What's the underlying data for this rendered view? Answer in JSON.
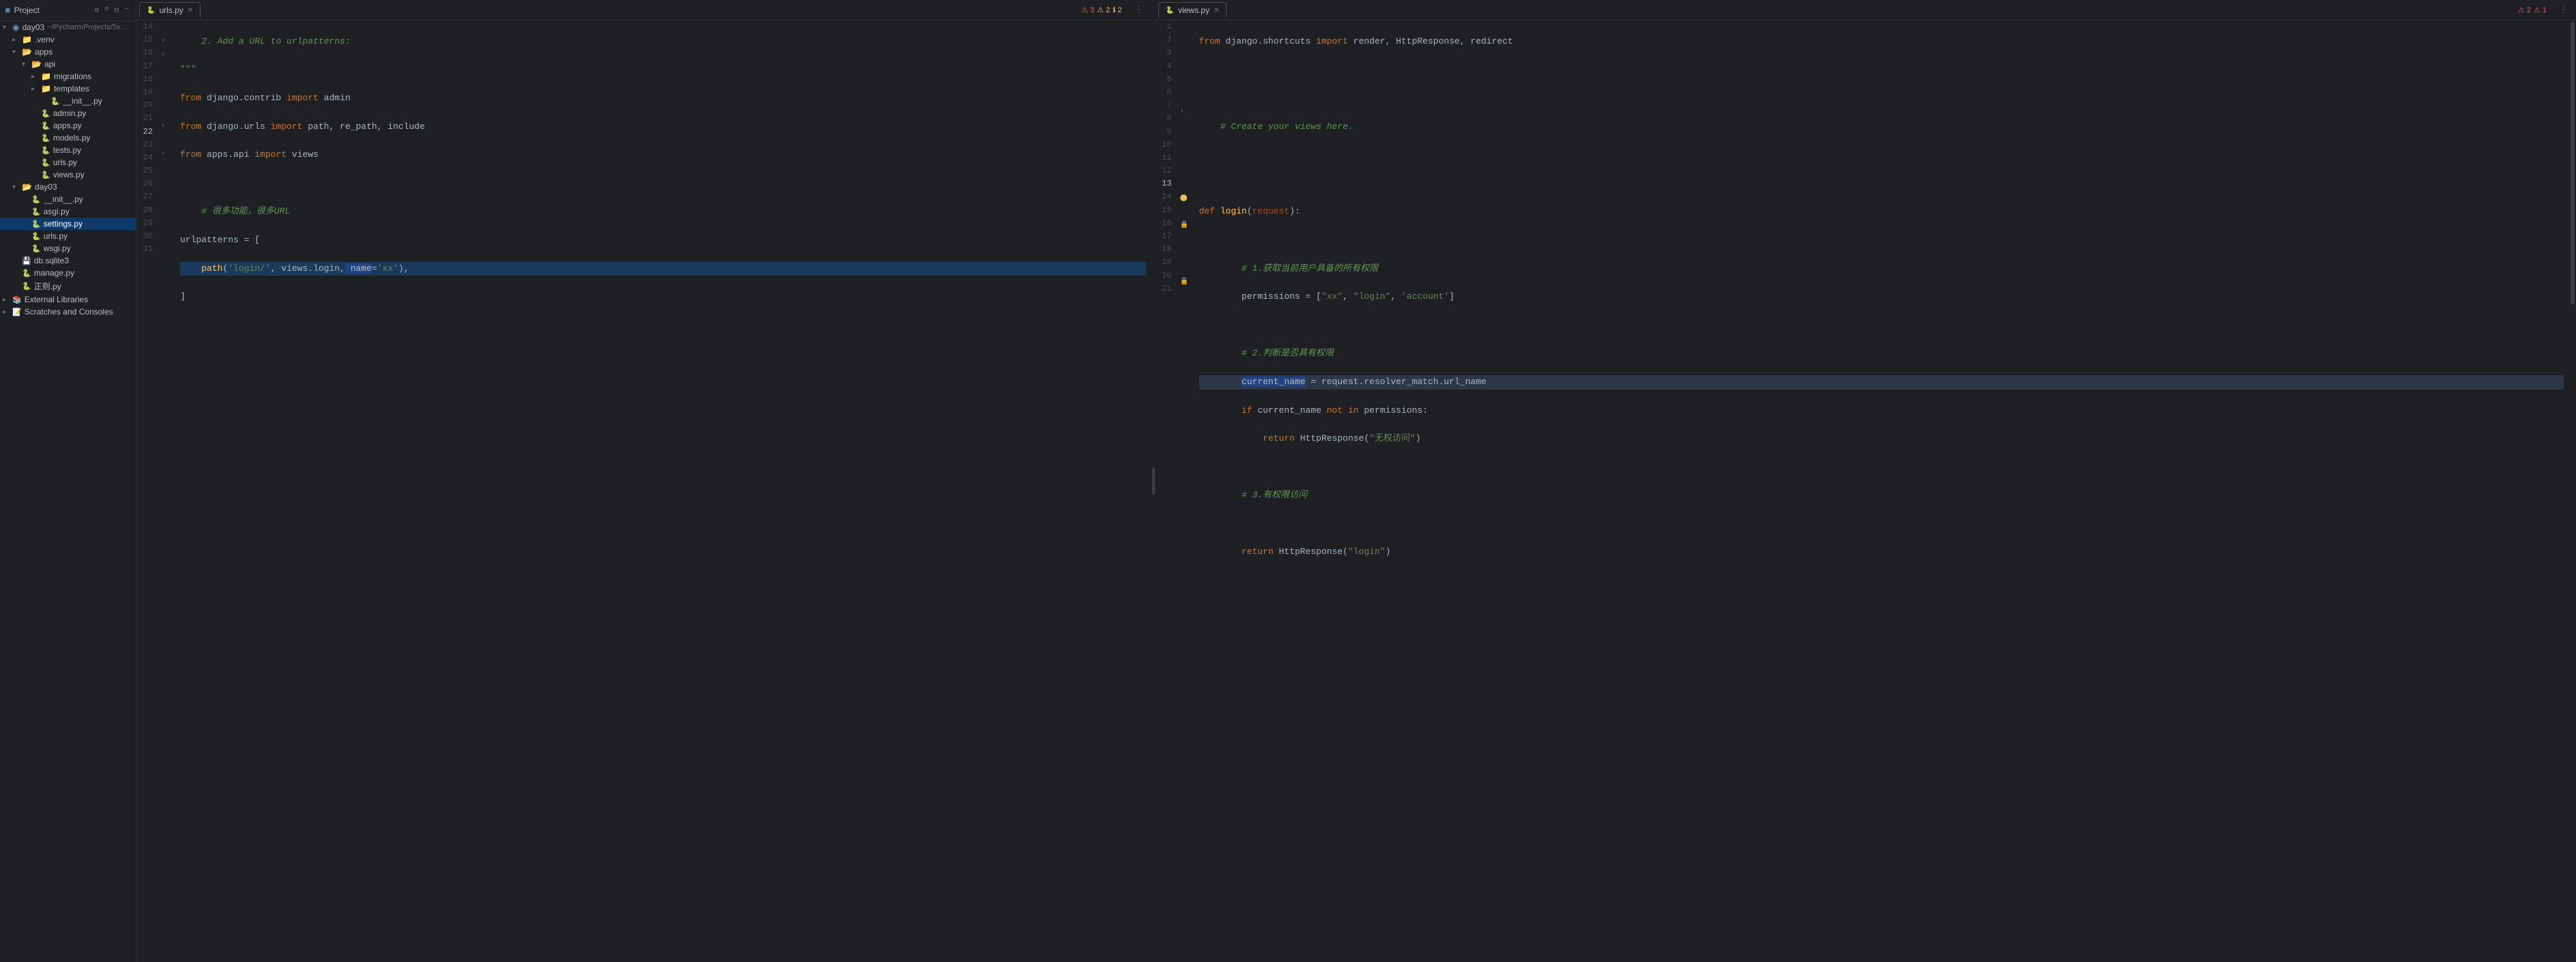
{
  "sidebar": {
    "title": "Project",
    "root": {
      "label": "day03",
      "sublabel": "~/PycharmProjects/5x...",
      "expanded": true
    },
    "items": [
      {
        "id": "venv",
        "label": ".venv",
        "type": "folder",
        "depth": 1,
        "expanded": true
      },
      {
        "id": "apps",
        "label": "apps",
        "type": "folder",
        "depth": 1,
        "expanded": true
      },
      {
        "id": "api",
        "label": "api",
        "type": "folder",
        "depth": 2,
        "expanded": true
      },
      {
        "id": "migrations",
        "label": "migrations",
        "type": "folder",
        "depth": 3,
        "expanded": false
      },
      {
        "id": "templates",
        "label": "templates",
        "type": "folder",
        "depth": 3,
        "expanded": false
      },
      {
        "id": "init_api",
        "label": "__init__.py",
        "type": "py",
        "depth": 4,
        "expanded": false
      },
      {
        "id": "admin_py",
        "label": "admin.py",
        "type": "py",
        "depth": 3,
        "expanded": false
      },
      {
        "id": "apps_py",
        "label": "apps.py",
        "type": "py",
        "depth": 3,
        "expanded": false
      },
      {
        "id": "models_py",
        "label": "models.py",
        "type": "py",
        "depth": 3,
        "expanded": false
      },
      {
        "id": "tests_py",
        "label": "tests.py",
        "type": "py",
        "depth": 3,
        "expanded": false
      },
      {
        "id": "urls_py_api",
        "label": "urls.py",
        "type": "py",
        "depth": 3,
        "expanded": false
      },
      {
        "id": "views_py_api",
        "label": "views.py",
        "type": "py",
        "depth": 3,
        "expanded": false
      },
      {
        "id": "day03_root",
        "label": "day03",
        "type": "folder",
        "depth": 1,
        "expanded": true
      },
      {
        "id": "init_day03",
        "label": "__init__.py",
        "type": "py",
        "depth": 2,
        "expanded": false
      },
      {
        "id": "asgi_py",
        "label": "asgi.py",
        "type": "py",
        "depth": 2,
        "expanded": false
      },
      {
        "id": "settings_py",
        "label": "settings.py",
        "type": "py",
        "depth": 2,
        "expanded": false,
        "selected": true
      },
      {
        "id": "urls_py_day03",
        "label": "urls.py",
        "type": "py",
        "depth": 2,
        "expanded": false
      },
      {
        "id": "wsgi_py",
        "label": "wsgi.py",
        "type": "py",
        "depth": 2,
        "expanded": false
      },
      {
        "id": "db_sqlite",
        "label": "db.sqlite3",
        "type": "db",
        "depth": 1,
        "expanded": false
      },
      {
        "id": "manage_py",
        "label": "manage.py",
        "type": "py",
        "depth": 1,
        "expanded": false
      },
      {
        "id": "zhengze_py",
        "label": "正则.py",
        "type": "py",
        "depth": 1,
        "expanded": false
      },
      {
        "id": "external_libs",
        "label": "External Libraries",
        "type": "ext",
        "depth": 0,
        "expanded": false
      },
      {
        "id": "scratches",
        "label": "Scratches and Consoles",
        "type": "scratch",
        "depth": 0,
        "expanded": false
      }
    ]
  },
  "tabs_left": {
    "tabs": [
      {
        "id": "urls_tab",
        "label": "urls.py",
        "active": true,
        "closeable": true
      }
    ],
    "errors": [
      {
        "type": "error",
        "count": 3,
        "color": "red"
      },
      {
        "type": "warning",
        "count": 2,
        "color": "yellow"
      },
      {
        "type": "info",
        "count": 2,
        "color": "yellow"
      }
    ]
  },
  "tabs_right": {
    "tabs": [
      {
        "id": "views_tab",
        "label": "views.py",
        "active": true,
        "closeable": true
      }
    ],
    "errors": [
      {
        "type": "error",
        "count": 2,
        "color": "red"
      },
      {
        "type": "error2",
        "count": 1,
        "color": "red"
      }
    ]
  },
  "editor_left": {
    "lines": [
      {
        "num": 14,
        "content": "    2. Add a URL to urlpatterns:",
        "type": "comment-green"
      },
      {
        "num": 15,
        "content": "\"\"\"",
        "type": "plain"
      },
      {
        "num": 16,
        "content": "from django.contrib import admin",
        "type": "code"
      },
      {
        "num": 17,
        "content": "from django.urls import path, re_path, include",
        "type": "code"
      },
      {
        "num": 18,
        "content": "from apps.api import views",
        "type": "code"
      },
      {
        "num": 19,
        "content": "",
        "type": "blank"
      },
      {
        "num": 20,
        "content": "    # 很多功能，很多URL",
        "type": "comment"
      },
      {
        "num": 21,
        "content": "urlpatterns = [",
        "type": "code"
      },
      {
        "num": 22,
        "content": "    path('login/', views.login, name='xx'),",
        "type": "code-selected"
      },
      {
        "num": 23,
        "content": "]",
        "type": "code"
      },
      {
        "num": 24,
        "content": "",
        "type": "blank"
      },
      {
        "num": 25,
        "content": "",
        "type": "blank"
      },
      {
        "num": 26,
        "content": "",
        "type": "blank"
      },
      {
        "num": 27,
        "content": "",
        "type": "blank"
      },
      {
        "num": 28,
        "content": "",
        "type": "blank"
      },
      {
        "num": 29,
        "content": "",
        "type": "blank"
      },
      {
        "num": 30,
        "content": "",
        "type": "blank"
      },
      {
        "num": 31,
        "content": "",
        "type": "blank"
      }
    ]
  },
  "editor_right": {
    "lines": [
      {
        "num": 1,
        "content": "from django.shortcuts import render, HttpResponse, redirect",
        "type": "code"
      },
      {
        "num": 2,
        "content": "",
        "type": "blank"
      },
      {
        "num": 3,
        "content": "",
        "type": "blank"
      },
      {
        "num": 4,
        "content": "    # Create your views here.",
        "type": "comment"
      },
      {
        "num": 5,
        "content": "",
        "type": "blank"
      },
      {
        "num": 6,
        "content": "",
        "type": "blank"
      },
      {
        "num": 7,
        "content": "def login(request):",
        "type": "code"
      },
      {
        "num": 8,
        "content": "",
        "type": "blank"
      },
      {
        "num": 9,
        "content": "        # 1.获取当前用户具备的所有权限",
        "type": "comment"
      },
      {
        "num": 10,
        "content": "        permissions = [\"xx\", \"login\", 'account']",
        "type": "code"
      },
      {
        "num": 11,
        "content": "",
        "type": "blank"
      },
      {
        "num": 12,
        "content": "        # 2.判断是否具有权限",
        "type": "comment"
      },
      {
        "num": 13,
        "content": "        current_name = request.resolver_match.url_name",
        "type": "code-debug"
      },
      {
        "num": 14,
        "content": "        if current_name not in permissions:",
        "type": "code"
      },
      {
        "num": 15,
        "content": "            return HttpResponse(\"无权访问\")",
        "type": "code"
      },
      {
        "num": 16,
        "content": "",
        "type": "blank"
      },
      {
        "num": 17,
        "content": "        # 3.有权限访问",
        "type": "comment"
      },
      {
        "num": 18,
        "content": "",
        "type": "blank"
      },
      {
        "num": 19,
        "content": "        return HttpResponse(\"login\")",
        "type": "code"
      },
      {
        "num": 20,
        "content": "",
        "type": "blank"
      },
      {
        "num": 21,
        "content": "",
        "type": "blank"
      }
    ]
  }
}
